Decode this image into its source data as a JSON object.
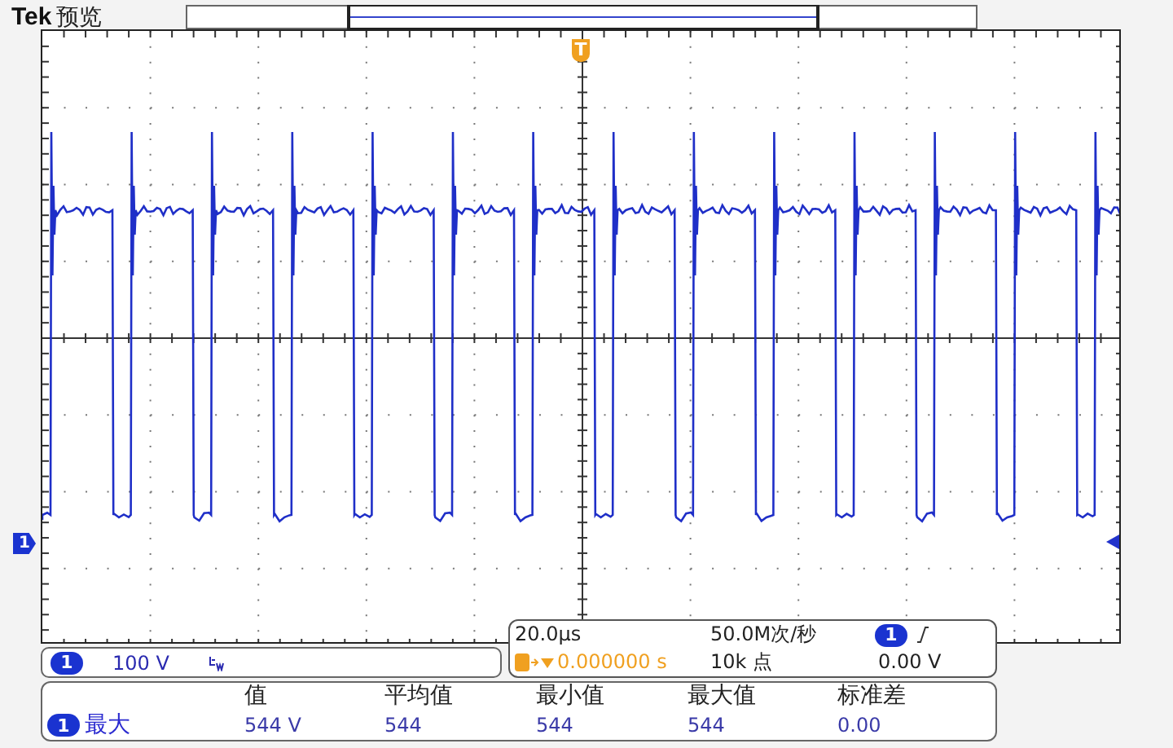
{
  "header": {
    "brand": "Tek",
    "mode": "预览"
  },
  "trigger_marker": "T",
  "channel_marker": "1",
  "channel_panel": {
    "channel": "1",
    "scale": "100 V",
    "bandwidth_limited": true
  },
  "timebase": {
    "scale": "20.0μs",
    "sample_rate": "50.0M次/秒",
    "trigger_channel": "1",
    "trigger_position": "0.000000 s",
    "record_length": "10k 点",
    "trigger_level": "0.00 V"
  },
  "measurements": {
    "headers": [
      "值",
      "平均值",
      "最小值",
      "最大值",
      "标准差"
    ],
    "rows": [
      {
        "channel": "1",
        "type": "最大",
        "values": [
          "544 V",
          "544",
          "544",
          "544",
          "0.00"
        ]
      }
    ]
  }
}
